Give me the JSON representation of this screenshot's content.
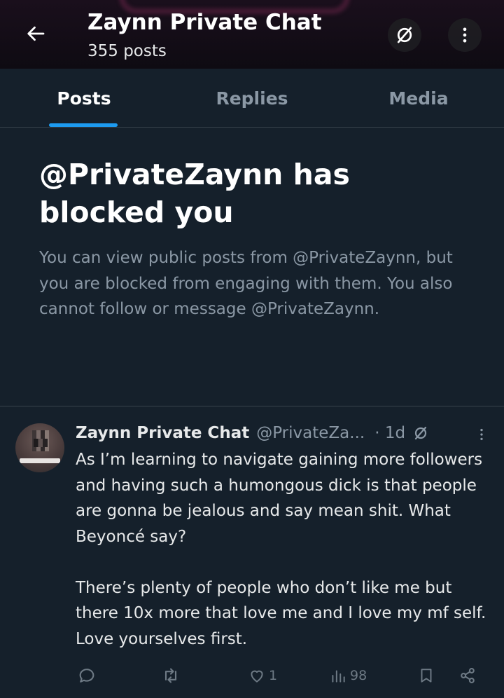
{
  "header": {
    "title": "Zaynn Private Chat",
    "post_count": "355 posts",
    "icons": {
      "back": "arrow-left-icon",
      "mute": "slashed-circle-icon",
      "more": "more-vertical-icon"
    }
  },
  "tabs": [
    {
      "label": "Posts",
      "active": true
    },
    {
      "label": "Replies",
      "active": false
    },
    {
      "label": "Media",
      "active": false
    }
  ],
  "blocked": {
    "title": "@PrivateZaynn has blocked you",
    "description": "You can view public posts from @PrivateZaynn, but you are blocked from engaging with them. You also cannot follow or message @PrivateZaynn."
  },
  "tweet": {
    "author_name": "Zaynn Private Chat",
    "handle": "@PrivateZa...",
    "time": "· 1d",
    "paragraphs": [
      "As I’m learning to navigate gaining more followers and having such a humongous dick is that people are gonna be jealous and say mean shit. What Beyoncé say?",
      "There’s plenty of people who don’t like me but there 10x more that love me and I love my mf self. Love yourselves first."
    ],
    "actions": {
      "reply_count": "",
      "repost_count": "",
      "like_count": "1",
      "view_count": "98"
    }
  },
  "colors": {
    "background": "#15202b",
    "accent": "#1d9bf0",
    "muted_text": "#8b98a5",
    "divider": "#38444d"
  }
}
